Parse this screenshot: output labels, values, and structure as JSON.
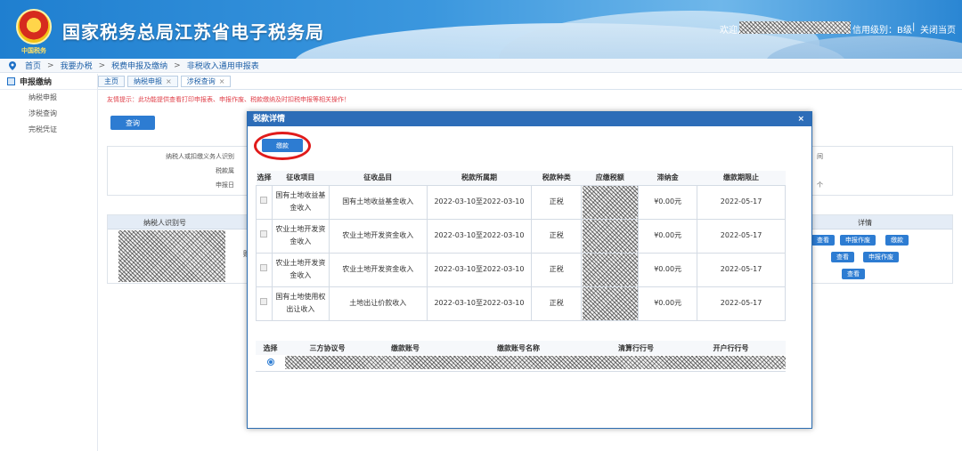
{
  "header": {
    "emblem_text": "中国税务",
    "title": "国家税务总局江苏省电子税务局",
    "welcome": "欢迎,",
    "credit": "信用级别：B级",
    "separator": "|",
    "close_page": "关闭当页"
  },
  "breadcrumb": [
    "首页",
    "我要办税",
    "税费申报及缴纳",
    "非税收入通用申报表"
  ],
  "breadcrumb_sep": ">",
  "sidebar": {
    "heading": "申报缴纳",
    "items": [
      "纳税申报",
      "涉税查询",
      "完税凭证"
    ]
  },
  "tabs": [
    {
      "label": "主页",
      "closable": false
    },
    {
      "label": "纳税申报",
      "closable": true
    },
    {
      "label": "涉税查询",
      "closable": true
    }
  ],
  "tab_close": "×",
  "main": {
    "tip": "友情提示：此功能提供查看打印申报表、申报作废、税款缴纳及时扣税申报等相关操作！",
    "query_button": "查询",
    "form_labels": [
      "纳税人或扣缴义务人识别",
      "税款属",
      "申报日"
    ],
    "table_headers": [
      "纳税人识别号",
      "详情"
    ],
    "partial_text": "财",
    "right_partial": [
      "间",
      "个"
    ],
    "row_buttons": [
      [
        "查看",
        "申报作废",
        "缴款"
      ],
      [
        "查看",
        "申报作废"
      ],
      [
        "查看"
      ]
    ]
  },
  "modal": {
    "title": "税款详情",
    "close": "×",
    "pay_button": "缴款",
    "columns": [
      "选择",
      "征收项目",
      "征收品目",
      "税款所属期",
      "税款种类",
      "应缴税额",
      "滞纳金",
      "缴款期限止"
    ],
    "rows": [
      {
        "item": "国有土地收益基金收入",
        "subitem": "国有土地收益基金收入",
        "period": "2022-03-10至2022-03-10",
        "kind": "正税",
        "late_fee": "¥0.00元",
        "deadline": "2022-05-17"
      },
      {
        "item": "农业土地开发资金收入",
        "subitem": "农业土地开发资金收入",
        "period": "2022-03-10至2022-03-10",
        "kind": "正税",
        "late_fee": "¥0.00元",
        "deadline": "2022-05-17"
      },
      {
        "item": "农业土地开发资金收入",
        "subitem": "农业土地开发资金收入",
        "period": "2022-03-10至2022-03-10",
        "kind": "正税",
        "late_fee": "¥0.00元",
        "deadline": "2022-05-17"
      },
      {
        "item": "国有土地使用权出让收入",
        "subitem": "土地出让价款收入",
        "period": "2022-03-10至2022-03-10",
        "kind": "正税",
        "late_fee": "¥0.00元",
        "deadline": "2022-05-17"
      }
    ],
    "account_columns": [
      "选择",
      "三方协议号",
      "缴款账号",
      "缴款账号名称",
      "清算行行号",
      "开户行行号"
    ]
  },
  "colors": {
    "header_blue": "#1f7fd0",
    "button_blue": "#2d7cd2",
    "modal_title_blue": "#2d6db8",
    "annotation_red": "#e01b1b",
    "tip_red": "#e0404a"
  }
}
